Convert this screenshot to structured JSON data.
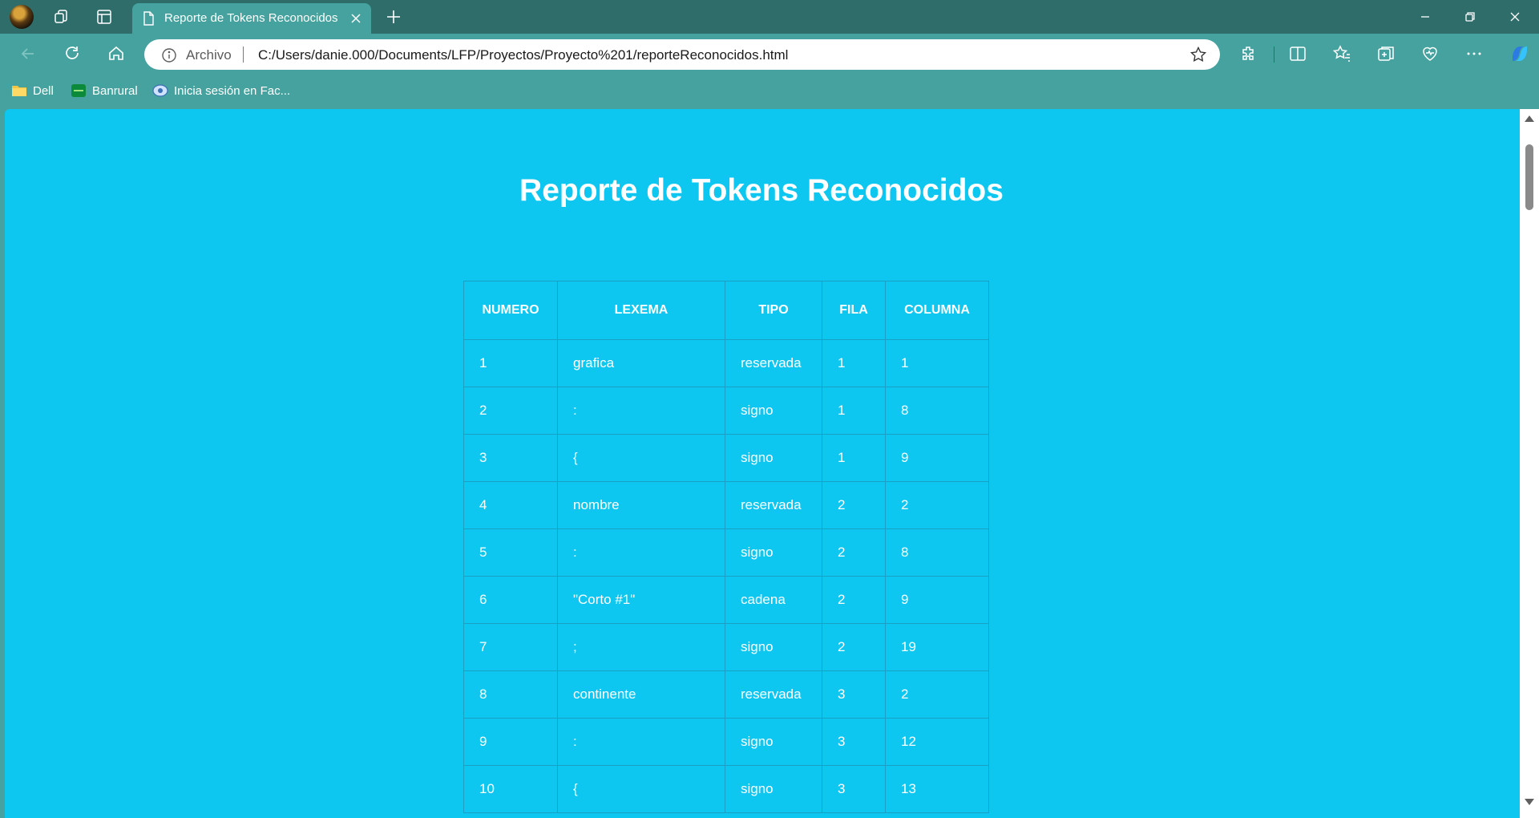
{
  "browser": {
    "tab": {
      "title": "Reporte de Tokens Reconocidos"
    },
    "address": {
      "label": "Archivo",
      "url": "C:/Users/danie.000/Documents/LFP/Proyectos/Proyecto%201/reporteReconocidos.html"
    },
    "bookmarks": [
      {
        "label": "Dell",
        "icon": "folder-icon"
      },
      {
        "label": "Banrural",
        "icon": "banrural-icon"
      },
      {
        "label": "Inicia sesión en Fac...",
        "icon": "facebook-site-icon"
      }
    ]
  },
  "page": {
    "title": "Reporte de Tokens Reconocidos",
    "table": {
      "headers": [
        "NUMERO",
        "LEXEMA",
        "TIPO",
        "FILA",
        "COLUMNA"
      ],
      "rows": [
        [
          "1",
          "grafica",
          "reservada",
          "1",
          "1"
        ],
        [
          "2",
          ":",
          "signo",
          "1",
          "8"
        ],
        [
          "3",
          "{",
          "signo",
          "1",
          "9"
        ],
        [
          "4",
          "nombre",
          "reservada",
          "2",
          "2"
        ],
        [
          "5",
          ":",
          "signo",
          "2",
          "8"
        ],
        [
          "6",
          "\"Corto #1\"",
          "cadena",
          "2",
          "9"
        ],
        [
          "7",
          ";",
          "signo",
          "2",
          "19"
        ],
        [
          "8",
          "continente",
          "reservada",
          "3",
          "2"
        ],
        [
          "9",
          ":",
          "signo",
          "3",
          "12"
        ],
        [
          "10",
          "{",
          "signo",
          "3",
          "13"
        ]
      ]
    }
  },
  "colors": {
    "page_background": "#0ec7f0",
    "browser_chrome": "#45a29e",
    "tab_strip": "#2e6d6a",
    "text": "#ffffff"
  }
}
